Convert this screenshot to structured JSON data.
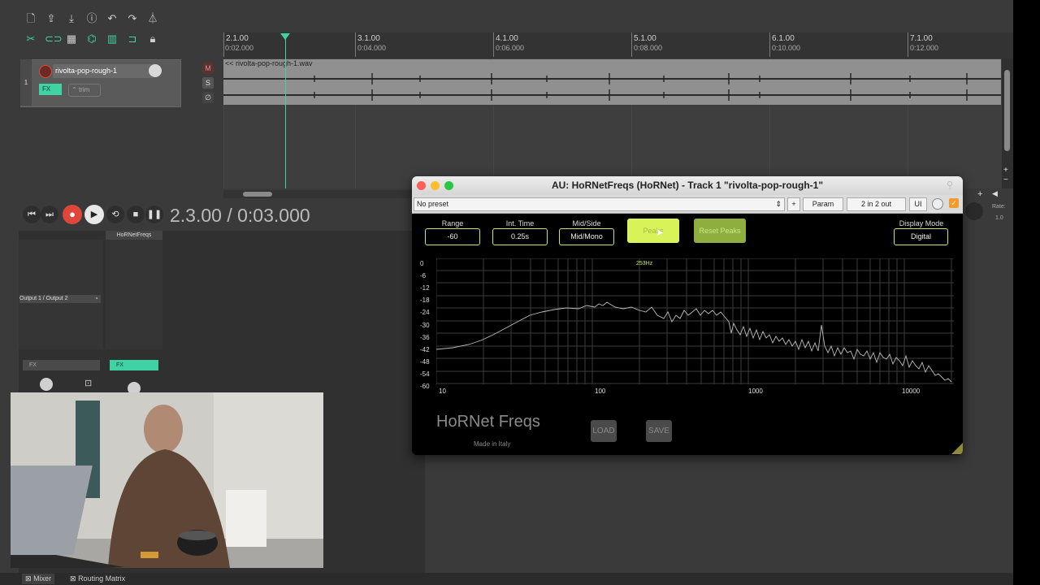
{
  "ruler": {
    "bars": [
      {
        "label": "2.1.00",
        "time": "0:02.000"
      },
      {
        "label": "3.1.00",
        "time": "0:04.000"
      },
      {
        "label": "4.1.00",
        "time": "0:06.000"
      },
      {
        "label": "5.1.00",
        "time": "0:08.000"
      },
      {
        "label": "6.1.00",
        "time": "0:10.000"
      },
      {
        "label": "7.1.00",
        "time": "0:12.000"
      }
    ]
  },
  "track": {
    "number": "1",
    "name": "rivolta-pop-rough-1",
    "fx_label": "FX",
    "trim_label": "trim",
    "mute_label": "M",
    "solo_label": "S",
    "phase_label": "∅"
  },
  "item": {
    "name": "<< rivolta-pop-rough-1.wav"
  },
  "transport": {
    "position": "2.3.00 / 0:03.000"
  },
  "mixer": {
    "strip_title": "HoRNetFreqs",
    "output_label": "Output 1 / Output 2",
    "fx_label_1": "FX",
    "fx_label_2": "FX"
  },
  "right_panel": {
    "rate_label": "Rate:",
    "rate_value": "1.0"
  },
  "plugin": {
    "window_title": "AU: HoRNetFreqs (HoRNet) - Track 1 \"rivolta-pop-rough-1\"",
    "preset": "No preset",
    "add_label": "+",
    "param_label": "Param",
    "io_label": "2 in 2 out",
    "ui_label": "UI",
    "range_label": "Range",
    "range_value": "-60",
    "int_time_label": "Int. Time",
    "int_time_value": "0.25s",
    "midside_label": "Mid/Side",
    "midside_value": "Mid/Mono",
    "peaks_label": "Peaks",
    "reset_peaks_label": "Reset Peaks",
    "display_mode_label": "Display Mode",
    "display_mode_value": "Digital",
    "peak_freq": "253Hz",
    "db_labels": [
      "0",
      "-6",
      "-12",
      "-18",
      "-24",
      "-30",
      "-36",
      "-42",
      "-48",
      "-54",
      "-60"
    ],
    "hz_labels": [
      "10",
      "100",
      "1000",
      "10000"
    ],
    "brand": "HoRNet Freqs",
    "made_in": "Made in Italy",
    "load_label": "LOAD",
    "save_label": "SAVE"
  },
  "tabs": {
    "mixer": "Mixer",
    "routing": "Routing Matrix"
  },
  "colors": {
    "accent": "#3fd2a4",
    "plugin_green": "#c6e96a",
    "record": "#e0473a"
  }
}
